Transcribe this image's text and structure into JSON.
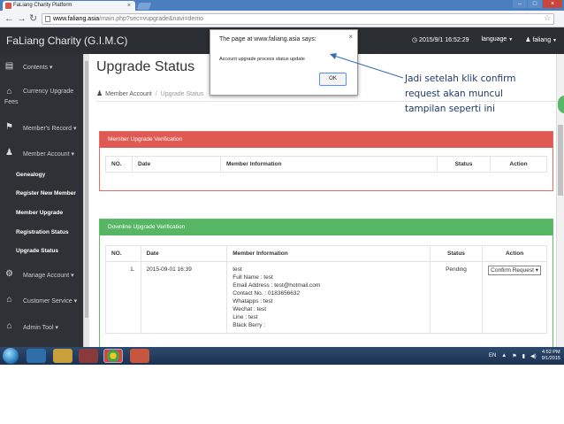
{
  "browser": {
    "tab_title": "FaLiang Charity Platform",
    "url_host": "www.faliang.asia",
    "url_path": "/main.php?sec=vupgrade&navi=demo"
  },
  "header": {
    "brand": "FaLiang Charity (G.I.M.C)",
    "datetime": "2015/9/1 16:52:29",
    "language": "language",
    "user": "faliang"
  },
  "sidebar": {
    "items": [
      {
        "label": "Contents",
        "icon": "newspaper-icon"
      },
      {
        "label": "Currency Upgrade",
        "label2": "Fees",
        "icon": "bank-icon"
      },
      {
        "label": "Member's Record",
        "icon": "flag-icon"
      },
      {
        "label": "Member Account",
        "icon": "users-icon"
      }
    ],
    "subitems": [
      "Genealogy",
      "Register New Member",
      "Member Upgrade",
      "Registration Status",
      "Upgrade Status"
    ],
    "items_bottom": [
      {
        "label": "Manage Account",
        "icon": "gears-icon"
      },
      {
        "label": "Customer Service",
        "icon": "bank-icon"
      },
      {
        "label": "Admin Tool",
        "icon": "bank-icon"
      }
    ]
  },
  "main": {
    "title": "Upgrade Status",
    "breadcrumb": [
      "Member Account",
      "Upgrade Status"
    ],
    "panel1": {
      "title": "Member Upgrade Verification",
      "columns": [
        "NO.",
        "Date",
        "Member Information",
        "Status",
        "Action"
      ]
    },
    "panel2": {
      "title": "Downline Upgrade Verification",
      "columns": [
        "NO.",
        "Date",
        "Member Information",
        "Status",
        "Action"
      ],
      "row": {
        "no": "1.",
        "date": "2015-09-01 16:39",
        "info": [
          "test",
          "Full Name : test",
          "Email Address : test@hotmail.com",
          "Contact No. : 0183656632",
          "Whatapps : test",
          "Wechat : test",
          "Line : test",
          "Black Berry :"
        ],
        "status": "Pending",
        "action": "Confirm Request"
      }
    }
  },
  "dialog": {
    "title": "The page at www.faliang.asia says:",
    "message": "Account upgrade process status update",
    "ok": "OK"
  },
  "annotation": {
    "lines": [
      "Jadi setelah klik confirm",
      "request akan muncul",
      "tampilan seperti ini"
    ]
  },
  "taskbar": {
    "lang": "EN",
    "time": "4:52 PM",
    "date": "9/1/2015"
  },
  "colors": {
    "header_bg": "#2b2f33",
    "sidebar_bg": "#2e3236",
    "panel_red": "#e05a53",
    "panel_green": "#56b664"
  }
}
